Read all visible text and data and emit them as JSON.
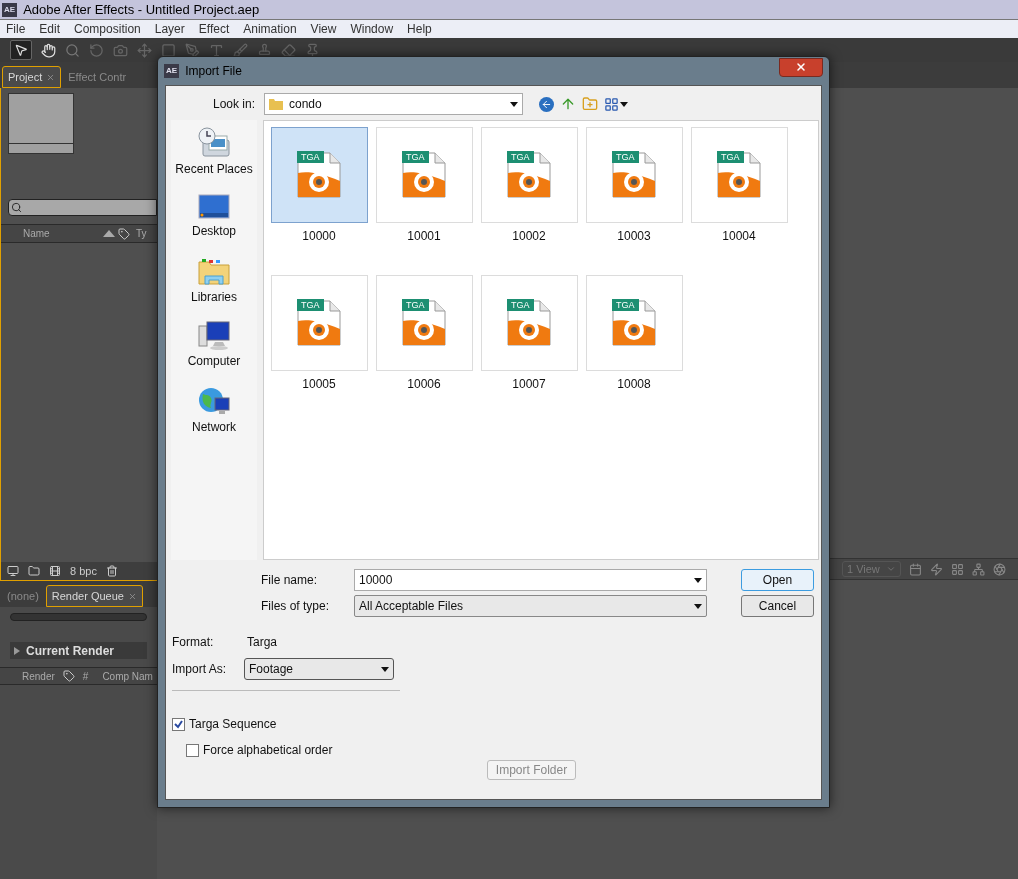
{
  "app": {
    "logo": "AE",
    "title": "Adobe After Effects - Untitled Project.aep",
    "menu": [
      "File",
      "Edit",
      "Composition",
      "Layer",
      "Effect",
      "Animation",
      "View",
      "Window",
      "Help"
    ],
    "project_panel": {
      "tabs": [
        {
          "label": "Project",
          "selected": true,
          "closable": true
        },
        {
          "label": "Effect Contr",
          "selected": false,
          "closable": false
        }
      ],
      "columns": [
        "Name",
        "Ty"
      ],
      "bpc": "8 bpc"
    },
    "render_panel": {
      "tabs": [
        {
          "label": "(none)",
          "selected": false,
          "closable": false
        },
        {
          "label": "Render Queue",
          "selected": true,
          "closable": true
        }
      ],
      "current_render": "Current Render",
      "columns": [
        "Render",
        "#",
        "Comp Nam"
      ]
    },
    "viewer": {
      "view_select": "1 View"
    }
  },
  "dialog": {
    "logo": "AE",
    "title": "Import File",
    "look_in": {
      "label": "Look in:",
      "value": "condo"
    },
    "places": [
      {
        "label": "Recent Places",
        "kind": "recent"
      },
      {
        "label": "Desktop",
        "kind": "desktop"
      },
      {
        "label": "Libraries",
        "kind": "libraries"
      },
      {
        "label": "Computer",
        "kind": "computer"
      },
      {
        "label": "Network",
        "kind": "network"
      }
    ],
    "files": [
      {
        "name": "10000",
        "badge": "TGA",
        "selected": true
      },
      {
        "name": "10001",
        "badge": "TGA",
        "selected": false
      },
      {
        "name": "10002",
        "badge": "TGA",
        "selected": false
      },
      {
        "name": "10003",
        "badge": "TGA",
        "selected": false
      },
      {
        "name": "10004",
        "badge": "TGA",
        "selected": false
      },
      {
        "name": "10005",
        "badge": "TGA",
        "selected": false
      },
      {
        "name": "10006",
        "badge": "TGA",
        "selected": false
      },
      {
        "name": "10007",
        "badge": "TGA",
        "selected": false
      },
      {
        "name": "10008",
        "badge": "TGA",
        "selected": false
      }
    ],
    "file_name": {
      "label": "File name:",
      "value": "10000"
    },
    "file_type": {
      "label": "Files of type:",
      "value": "All Acceptable Files"
    },
    "open_button": "Open",
    "cancel_button": "Cancel",
    "format": {
      "label": "Format:",
      "value": "Targa"
    },
    "import_as": {
      "label": "Import As:",
      "value": "Footage"
    },
    "options": [
      {
        "label": "Targa Sequence",
        "checked": true,
        "indented": false
      },
      {
        "label": "Force alphabetical order",
        "checked": false,
        "indented": true
      }
    ],
    "import_folder": {
      "label": "Import Folder",
      "disabled": true
    }
  }
}
